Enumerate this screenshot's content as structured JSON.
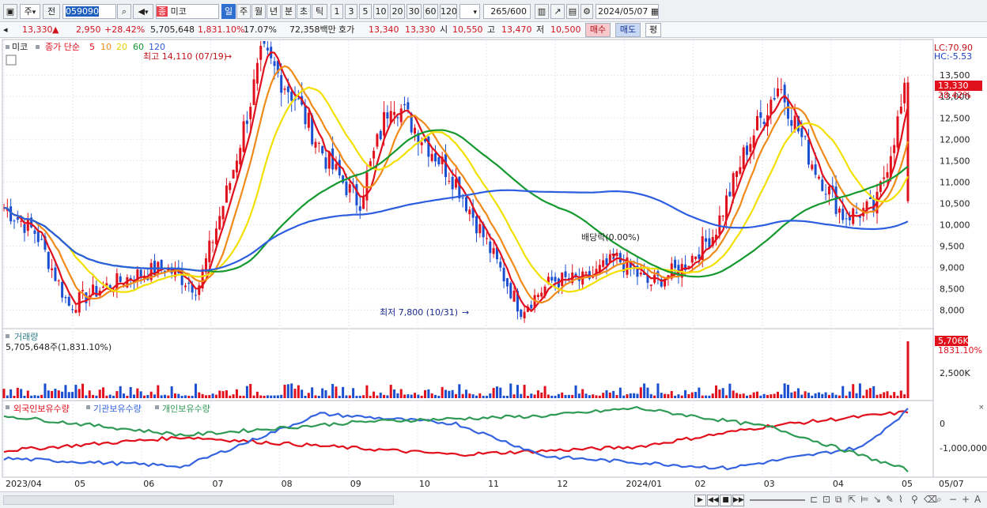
{
  "toolbar": {
    "period_combo": "주",
    "prev_label": "전",
    "stock_code": "059090",
    "type_badge": "종",
    "stock_name": "미코",
    "periods": [
      "일",
      "주",
      "월",
      "년",
      "분",
      "초",
      "틱"
    ],
    "active_period": "일",
    "counts": [
      "1",
      "3",
      "5",
      "10",
      "20",
      "30",
      "60",
      "120"
    ],
    "bar_count": "265",
    "bar_total": "/600",
    "date": "2024/05/07"
  },
  "info": {
    "price": "13,330",
    "arrow": "▲",
    "change": "2,950",
    "change_pct": "+28.42%",
    "volume": "5,705,648",
    "volume_pct": "1,831.10%",
    "turnover": "17.07%",
    "amount": "72,358백만",
    "quote_label": "호가",
    "ask": "13,340",
    "bid": "13,330",
    "open_label": "시",
    "open": "10,550",
    "high_label": "고",
    "high": "13,470",
    "low_label": "저",
    "low": "10,500",
    "buy_label": "매수",
    "sell_label": "매도",
    "eval_label": "평"
  },
  "price_panel": {
    "name": "미코",
    "ma_label": "종가 단순",
    "ma_periods": [
      "5",
      "10",
      "20",
      "60",
      "120"
    ],
    "max_annotation": "최고 14,110 (07/19)",
    "min_annotation": "최저 7,800 (10/31)",
    "event_annotation": "배당락(0.00%)",
    "lc": "LC:70.90",
    "hc": "HC:-5.53",
    "current_tag": "13,330",
    "current_pct": "28.42%",
    "y_ticks": [
      "13,500",
      "13,000",
      "12,500",
      "12,000",
      "11,500",
      "11,000",
      "10,500",
      "10,000",
      "9,500",
      "9,000",
      "8,500",
      "8,000"
    ]
  },
  "volume_panel": {
    "title": "거래량",
    "value": "5,705,648주(1,831.10%)",
    "tag": "5,706K",
    "tag_pct": "1831.10%",
    "y_tick": "2,500K"
  },
  "holding_panel": {
    "legend": [
      "외국인보유수량",
      "기관보유수량",
      "개인보유수량"
    ],
    "y_ticks": [
      "0",
      "-1,000,000"
    ]
  },
  "x_axis": [
    "2023/04",
    "05",
    "06",
    "07",
    "08",
    "09",
    "10",
    "11",
    "12",
    "2024/01",
    "02",
    "03",
    "04",
    "05",
    "05/07"
  ],
  "colors": {
    "up": "#e0101c",
    "down": "#1a4fd0",
    "ma5": "#e0101c",
    "ma10": "#f08a18",
    "ma20": "#f2e000",
    "ma60": "#14992e",
    "ma120": "#2d5ee0",
    "foreign": "#e0101c",
    "institution": "#3563e0",
    "individual": "#2e9a55"
  },
  "chart_data": [
    {
      "type": "candlestick",
      "title": "미코 종가 단순 5 10 20 60 120",
      "x_range": [
        "2023/04",
        "2024/05/07"
      ],
      "ylim": [
        7600,
        14300
      ],
      "last": {
        "date": "2024/05/07",
        "open": 10550,
        "high": 13470,
        "low": 10500,
        "close": 13330
      },
      "high": {
        "value": 14110,
        "date": "07/19"
      },
      "low": {
        "value": 7800,
        "date": "10/31"
      },
      "close_path": [
        {
          "x": "2023/04",
          "y": 10400
        },
        {
          "x": "04 mid",
          "y": 9800
        },
        {
          "x": "04 late",
          "y": 8100
        },
        {
          "x": "05 mid",
          "y": 8500
        },
        {
          "x": "05 late",
          "y": 8800
        },
        {
          "x": "06 mid",
          "y": 9000
        },
        {
          "x": "06 late",
          "y": 8500
        },
        {
          "x": "07 early",
          "y": 11000
        },
        {
          "x": "07/19",
          "y": 14000
        },
        {
          "x": "07 late",
          "y": 13000
        },
        {
          "x": "08 mid",
          "y": 11500
        },
        {
          "x": "08 late",
          "y": 10500
        },
        {
          "x": "09 early",
          "y": 13000
        },
        {
          "x": "09 mid",
          "y": 12000
        },
        {
          "x": "09 late",
          "y": 11000
        },
        {
          "x": "10 mid",
          "y": 9500
        },
        {
          "x": "10/31",
          "y": 8000
        },
        {
          "x": "11 mid",
          "y": 8700
        },
        {
          "x": "12 early",
          "y": 8700
        },
        {
          "x": "12 mid",
          "y": 9200
        },
        {
          "x": "2024/01 mid",
          "y": 8600
        },
        {
          "x": "02 mid",
          "y": 9000
        },
        {
          "x": "03 early",
          "y": 9800
        },
        {
          "x": "03 mid",
          "y": 11800
        },
        {
          "x": "04 early",
          "y": 13300
        },
        {
          "x": "04 mid",
          "y": 11500
        },
        {
          "x": "04 late",
          "y": 10200
        },
        {
          "x": "05 early",
          "y": 10400
        },
        {
          "x": "05/07",
          "y": 13330
        }
      ],
      "ma_periods": [
        "5",
        "10",
        "20",
        "60",
        "120"
      ]
    },
    {
      "type": "bar",
      "title": "거래량",
      "last_value": 5705648,
      "last_pct": "1,831.10%"
    },
    {
      "type": "line",
      "series": [
        {
          "name": "외국인보유수량",
          "path": [
            [
              0,
              -800000
            ],
            [
              0.2,
              -450000
            ],
            [
              0.5,
              -900000
            ],
            [
              0.7,
              -700000
            ],
            [
              0.85,
              -150000
            ],
            [
              1.0,
              200000
            ]
          ]
        },
        {
          "name": "기관보유수량",
          "path": [
            [
              0,
              -1000000
            ],
            [
              0.2,
              -1200000
            ],
            [
              0.35,
              150000
            ],
            [
              0.5,
              -100000
            ],
            [
              0.6,
              -950000
            ],
            [
              0.8,
              -1250000
            ],
            [
              0.95,
              -700000
            ],
            [
              1.0,
              250000
            ]
          ]
        },
        {
          "name": "개인보유수량",
          "path": [
            [
              0,
              100000
            ],
            [
              0.2,
              -400000
            ],
            [
              0.4,
              -50000
            ],
            [
              0.6,
              100000
            ],
            [
              0.7,
              300000
            ],
            [
              0.85,
              -200000
            ],
            [
              1.0,
              -1300000
            ]
          ]
        }
      ],
      "y_ticks": [
        0,
        -1000000
      ]
    }
  ]
}
